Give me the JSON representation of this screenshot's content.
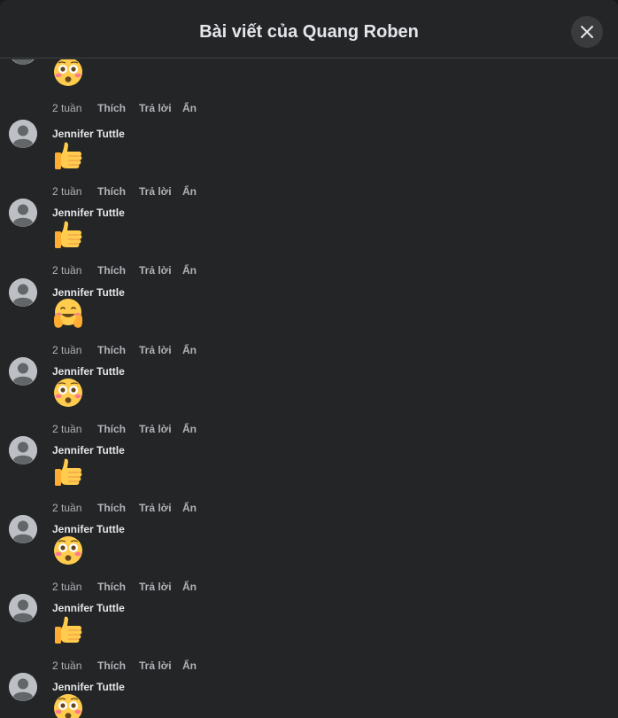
{
  "header": {
    "title": "Bài viết của Quang Roben",
    "close_icon": "close-icon"
  },
  "comments": [
    {
      "author": "",
      "emoji": "flushed",
      "time": "2 tuần",
      "like": "Thích",
      "reply": "Trả lời",
      "hide": "Ẩn"
    },
    {
      "author": "Jennifer Tuttle",
      "emoji": "thumbs-up",
      "time": "2 tuần",
      "like": "Thích",
      "reply": "Trả lời",
      "hide": "Ẩn"
    },
    {
      "author": "Jennifer Tuttle",
      "emoji": "thumbs-up",
      "time": "2 tuần",
      "like": "Thích",
      "reply": "Trả lời",
      "hide": "Ẩn"
    },
    {
      "author": "Jennifer Tuttle",
      "emoji": "hugging",
      "time": "2 tuần",
      "like": "Thích",
      "reply": "Trả lời",
      "hide": "Ẩn"
    },
    {
      "author": "Jennifer Tuttle",
      "emoji": "flushed",
      "time": "2 tuần",
      "like": "Thích",
      "reply": "Trả lời",
      "hide": "Ẩn"
    },
    {
      "author": "Jennifer Tuttle",
      "emoji": "thumbs-up",
      "time": "2 tuần",
      "like": "Thích",
      "reply": "Trả lời",
      "hide": "Ẩn"
    },
    {
      "author": "Jennifer Tuttle",
      "emoji": "flushed",
      "time": "2 tuần",
      "like": "Thích",
      "reply": "Trả lời",
      "hide": "Ẩn"
    },
    {
      "author": "Jennifer Tuttle",
      "emoji": "thumbs-up",
      "time": "2 tuần",
      "like": "Thích",
      "reply": "Trả lời",
      "hide": "Ẩn"
    },
    {
      "author": "Jennifer Tuttle",
      "emoji": "flushed",
      "time": "",
      "like": "",
      "reply": "",
      "hide": ""
    }
  ],
  "colors": {
    "background": "#242526",
    "text_primary": "#e4e6eb",
    "text_secondary": "#b0b3b8",
    "avatar": "#bcc0c4",
    "emoji_yellow": "#ffcc4d"
  }
}
